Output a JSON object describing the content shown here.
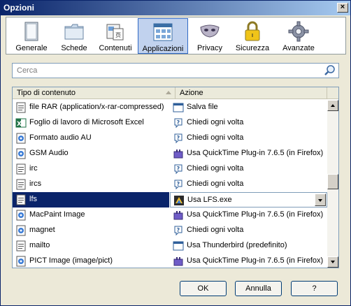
{
  "window": {
    "title": "Opzioni",
    "close_label": "×"
  },
  "toolbar": {
    "items": [
      {
        "label": "Generale",
        "icon": "window-icon"
      },
      {
        "label": "Schede",
        "icon": "folder-tabs-icon"
      },
      {
        "label": "Contenuti",
        "icon": "page-icon"
      },
      {
        "label": "Applicazioni",
        "icon": "applications-icon",
        "selected": true
      },
      {
        "label": "Privacy",
        "icon": "mask-icon"
      },
      {
        "label": "Sicurezza",
        "icon": "padlock-icon"
      },
      {
        "label": "Avanzate",
        "icon": "gear-icon"
      }
    ]
  },
  "search": {
    "placeholder": "Cerca"
  },
  "table": {
    "columns": [
      "Tipo di contenuto",
      "Azione"
    ],
    "rows": [
      {
        "type": "file RAR (application/x-rar-compressed)",
        "type_icon": "generic-file-icon",
        "action": "Salva file",
        "action_icon": "save-file-icon"
      },
      {
        "type": "Foglio di lavoro di Microsoft Excel",
        "type_icon": "excel-icon",
        "action": "Chiedi ogni volta",
        "action_icon": "question-icon"
      },
      {
        "type": "Formato audio AU",
        "type_icon": "audio-file-icon",
        "action": "Chiedi ogni volta",
        "action_icon": "question-icon"
      },
      {
        "type": "GSM Audio",
        "type_icon": "audio-file-icon",
        "action": "Usa QuickTime Plug-in 7.6.5 (in Firefox)",
        "action_icon": "plugin-icon"
      },
      {
        "type": "irc",
        "type_icon": "generic-file-icon",
        "action": "Chiedi ogni volta",
        "action_icon": "question-icon"
      },
      {
        "type": "ircs",
        "type_icon": "generic-file-icon",
        "action": "Chiedi ogni volta",
        "action_icon": "question-icon"
      },
      {
        "type": "lfs",
        "type_icon": "generic-file-icon",
        "action": "Usa LFS.exe",
        "action_icon": "lfs-exe-icon",
        "selected": true
      },
      {
        "type": "MacPaint Image",
        "type_icon": "audio-file-icon",
        "action": "Usa QuickTime Plug-in 7.6.5 (in Firefox)",
        "action_icon": "plugin-icon"
      },
      {
        "type": "magnet",
        "type_icon": "audio-file-icon",
        "action": "Chiedi ogni volta",
        "action_icon": "question-icon"
      },
      {
        "type": "mailto",
        "type_icon": "generic-file-icon",
        "action": "Usa Thunderbird (predefinito)",
        "action_icon": "save-file-icon"
      },
      {
        "type": "PICT Image (image/pict)",
        "type_icon": "audio-file-icon",
        "action": "Usa QuickTime Plug-in 7.6.5 (in Firefox)",
        "action_icon": "plugin-icon"
      }
    ]
  },
  "buttons": {
    "ok": "OK",
    "cancel": "Annulla",
    "help": "?"
  },
  "colors": {
    "selection": "#0a246a",
    "toolbar_selected": "#c1d2ee",
    "dialog_bg": "#ece9d8"
  }
}
